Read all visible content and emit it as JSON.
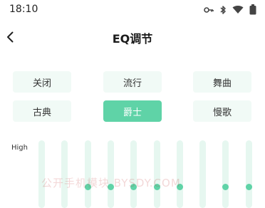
{
  "status_bar": {
    "time": "18:10",
    "icons": [
      "key-icon",
      "bluetooth-icon",
      "wifi-icon",
      "battery-icon"
    ]
  },
  "nav": {
    "back_icon": "chevron-left-icon",
    "title": "EQ调节"
  },
  "presets": [
    {
      "label": "关闭",
      "active": false
    },
    {
      "label": "流行",
      "active": false
    },
    {
      "label": "舞曲",
      "active": false
    },
    {
      "label": "古典",
      "active": false
    },
    {
      "label": "爵士",
      "active": true
    },
    {
      "label": "慢歌",
      "active": false
    }
  ],
  "equalizer": {
    "high_label": "High",
    "bands": [
      {
        "knob_visible": false
      },
      {
        "knob_visible": false
      },
      {
        "knob_visible": true
      },
      {
        "knob_visible": true
      },
      {
        "knob_visible": true
      },
      {
        "knob_visible": true
      },
      {
        "knob_visible": true
      },
      {
        "knob_visible": false
      },
      {
        "knob_visible": true
      },
      {
        "knob_visible": true
      },
      {
        "knob_visible": true
      }
    ]
  },
  "watermark": "公开手机模块 BYSDY.COM",
  "colors": {
    "accent": "#5fd3a7",
    "preset_bg": "#f1faf6",
    "track_bg": "#e6f7f0",
    "text": "#333333"
  }
}
